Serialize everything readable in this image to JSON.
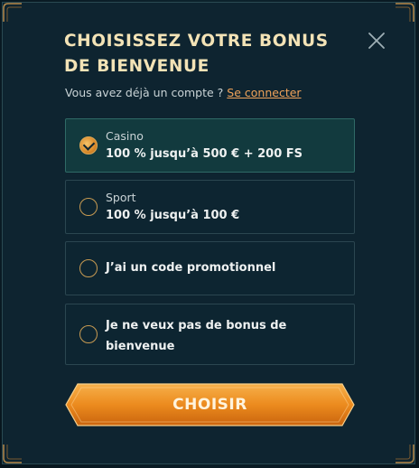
{
  "modal": {
    "title": "CHOISISSEZ VOTRE BONUS DE BIENVENUE",
    "account_prompt": "Vous avez déjà un compte ?",
    "login_link": "Se connecter",
    "options": [
      {
        "label": "Casino",
        "value": "100 % jusqu’à 500 € + 200 FS",
        "selected": true
      },
      {
        "label": "Sport",
        "value": "100 % jusqu’à 100 €",
        "selected": false
      },
      {
        "label": "J’ai un code promotionnel",
        "selected": false
      },
      {
        "label": "Je ne veux pas de bonus de bienvenue",
        "selected": false
      }
    ],
    "cta_label": "CHOISIR"
  },
  "colors": {
    "accent": "#e98a22",
    "title": "#f3e3b6",
    "link": "#f0a35a",
    "selected_bg": "#123a3e"
  }
}
